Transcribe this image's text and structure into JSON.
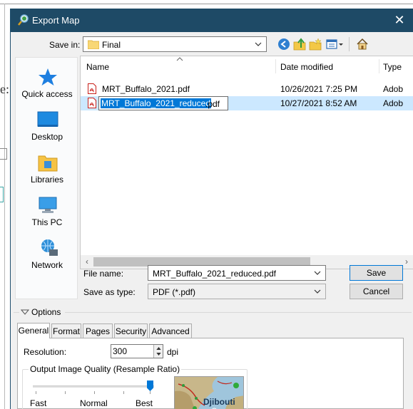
{
  "dialog": {
    "title": "Export Map",
    "close_symbol": "✕",
    "save_in_label": "Save in:",
    "save_in_value": "Final",
    "toolbar_icons": [
      "back-icon",
      "up-folder-icon",
      "new-folder-icon",
      "view-menu-icon",
      "home-icon"
    ]
  },
  "background": {
    "left_fragment": "e:"
  },
  "places": [
    {
      "label": "Quick access",
      "icon": "quick-access-star-icon"
    },
    {
      "label": "Desktop",
      "icon": "desktop-icon"
    },
    {
      "label": "Libraries",
      "icon": "libraries-icon"
    },
    {
      "label": "This PC",
      "icon": "this-pc-icon"
    },
    {
      "label": "Network",
      "icon": "network-icon"
    }
  ],
  "filelist": {
    "columns": {
      "name": "Name",
      "date": "Date modified",
      "type": "Type"
    },
    "rows": [
      {
        "name": "MRT_Buffalo_2021.pdf",
        "date": "10/26/2021 7:25 PM",
        "type": "Adob"
      },
      {
        "name_selected": "MRT_Buffalo_2021_reduced",
        "name_rest": ".pdf",
        "date": "10/27/2021 8:52 AM",
        "type": "Adob"
      }
    ]
  },
  "form": {
    "filename_label": "File name:",
    "filename_value": "MRT_Buffalo_2021_reduced.pdf",
    "savetype_label": "Save as type:",
    "savetype_value": "PDF (*.pdf)",
    "save_button": "Save",
    "cancel_button": "Cancel"
  },
  "options": {
    "label": "Options",
    "tabs": [
      "General",
      "Format",
      "Pages",
      "Security",
      "Advanced"
    ],
    "active_tab": "General",
    "resolution_label": "Resolution:",
    "resolution_value": "300",
    "resolution_unit": "dpi",
    "quality_group_label": "Output Image Quality (Resample Ratio)",
    "slider_labels": [
      "Fast",
      "Normal",
      "Best"
    ],
    "slider_level_fraction": 1.0,
    "preview_label": "Djibouti"
  },
  "colors": {
    "titlebar": "#1e4a66",
    "selection": "#cce8ff",
    "accent": "#0078d7"
  }
}
